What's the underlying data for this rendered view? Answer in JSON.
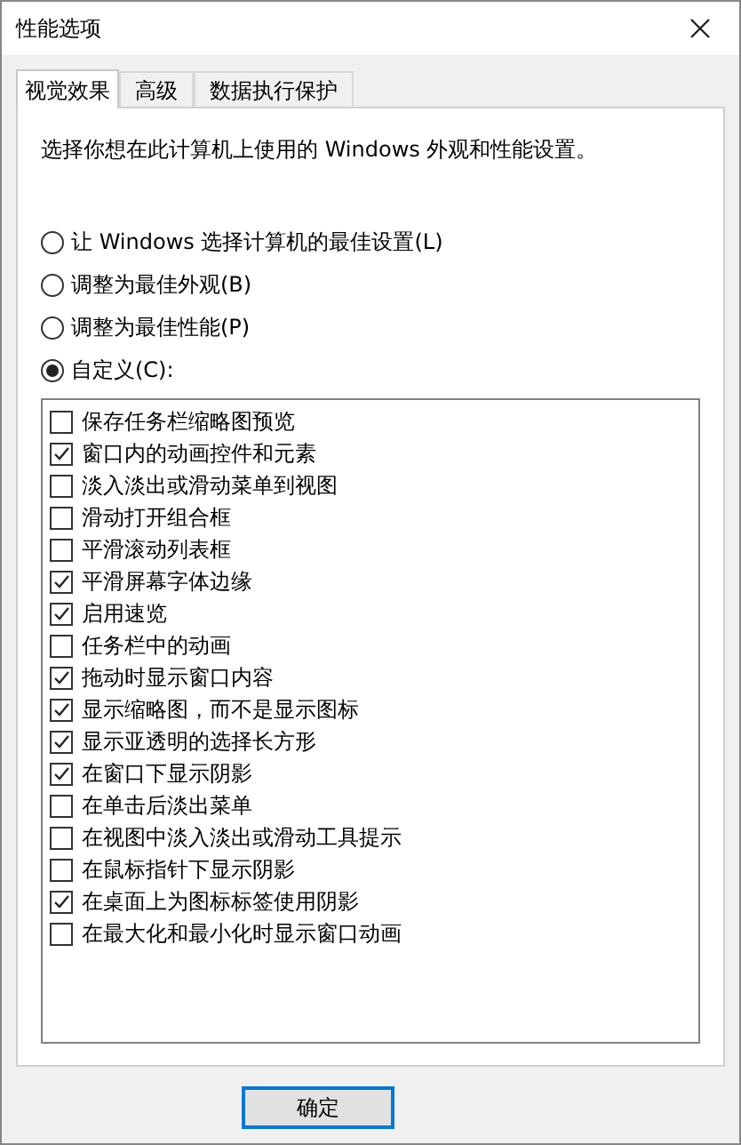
{
  "window": {
    "title": "性能选项"
  },
  "tabs": [
    {
      "label": "视觉效果",
      "selected": true
    },
    {
      "label": "高级",
      "selected": false
    },
    {
      "label": "数据执行保护",
      "selected": false
    }
  ],
  "description": "选择你想在此计算机上使用的 Windows 外观和性能设置。",
  "radios": [
    {
      "label": "让 Windows 选择计算机的最佳设置(L)",
      "selected": false
    },
    {
      "label": "调整为最佳外观(B)",
      "selected": false
    },
    {
      "label": "调整为最佳性能(P)",
      "selected": false
    },
    {
      "label": "自定义(C):",
      "selected": true
    }
  ],
  "options": [
    {
      "label": "保存任务栏缩略图预览",
      "checked": false
    },
    {
      "label": "窗口内的动画控件和元素",
      "checked": true
    },
    {
      "label": "淡入淡出或滑动菜单到视图",
      "checked": false
    },
    {
      "label": "滑动打开组合框",
      "checked": false
    },
    {
      "label": "平滑滚动列表框",
      "checked": false
    },
    {
      "label": "平滑屏幕字体边缘",
      "checked": true
    },
    {
      "label": "启用速览",
      "checked": true
    },
    {
      "label": "任务栏中的动画",
      "checked": false
    },
    {
      "label": "拖动时显示窗口内容",
      "checked": true
    },
    {
      "label": "显示缩略图，而不是显示图标",
      "checked": true
    },
    {
      "label": "显示亚透明的选择长方形",
      "checked": true
    },
    {
      "label": "在窗口下显示阴影",
      "checked": true
    },
    {
      "label": "在单击后淡出菜单",
      "checked": false
    },
    {
      "label": "在视图中淡入淡出或滑动工具提示",
      "checked": false
    },
    {
      "label": "在鼠标指针下显示阴影",
      "checked": false
    },
    {
      "label": "在桌面上为图标标签使用阴影",
      "checked": true
    },
    {
      "label": "在最大化和最小化时显示窗口动画",
      "checked": false
    }
  ],
  "buttons": [
    "确定"
  ]
}
